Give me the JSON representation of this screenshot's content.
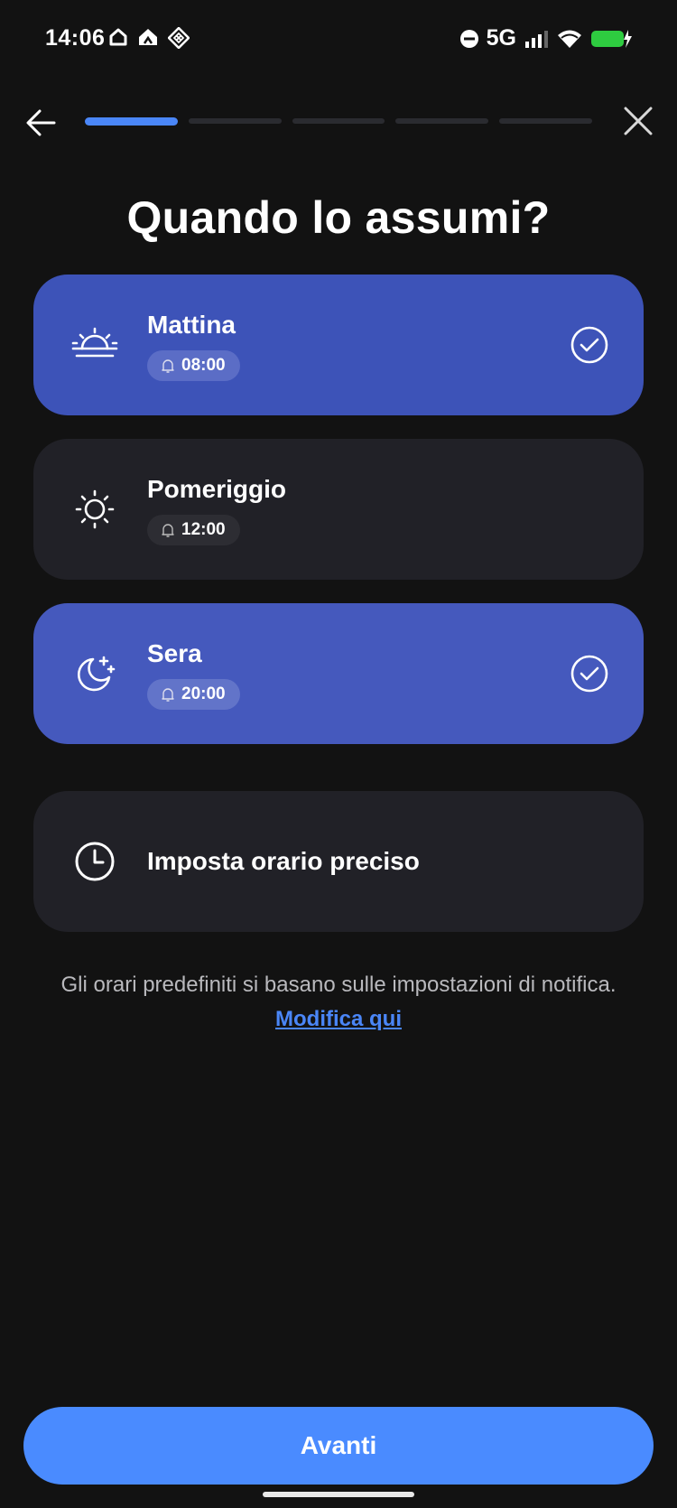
{
  "status_bar": {
    "time": "14:06",
    "network": "5G",
    "left_icons": [
      "home-icon",
      "home-alt-icon",
      "diamond-app-icon"
    ],
    "right_icons": [
      "dnd-icon",
      "signal-icon",
      "wifi-icon",
      "battery-charging-icon"
    ],
    "battery_color": "#2ecc40"
  },
  "nav": {
    "steps_total": 5,
    "steps_current": 1,
    "accent": "#4a86f7"
  },
  "page": {
    "title": "Quando lo assumi?"
  },
  "options": [
    {
      "label": "Mattina",
      "time": "08:00",
      "icon": "sunrise-icon",
      "selected": true
    },
    {
      "label": "Pomeriggio",
      "time": "12:00",
      "icon": "sun-icon",
      "selected": false
    },
    {
      "label": "Sera",
      "time": "20:00",
      "icon": "moon-stars-icon",
      "selected": true
    },
    {
      "label": "Imposta orario preciso",
      "icon": "clock-icon",
      "selected": false
    }
  ],
  "note": {
    "text": "Gli orari predefiniti si basano sulle impostazioni di notifica.",
    "link": "Modifica qui"
  },
  "footer": {
    "next_label": "Avanti"
  }
}
